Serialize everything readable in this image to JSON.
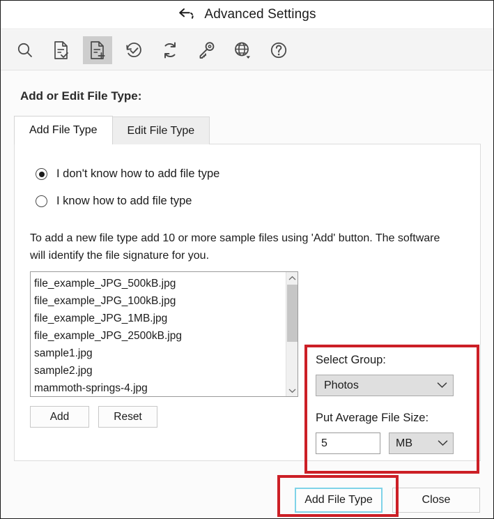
{
  "window": {
    "title": "Advanced Settings",
    "back_icon": "back-arrow-icon"
  },
  "toolbar": {
    "items": [
      {
        "icon": "search-icon",
        "name": "search",
        "active": false
      },
      {
        "icon": "document-check-icon",
        "name": "verify-file-type",
        "active": false
      },
      {
        "icon": "document-plus-icon",
        "name": "add-file-type",
        "active": true
      },
      {
        "icon": "clock-check-icon",
        "name": "recovery-history",
        "active": false
      },
      {
        "icon": "refresh-icon",
        "name": "refresh",
        "active": false
      },
      {
        "icon": "key-icon",
        "name": "license-key",
        "active": false
      },
      {
        "icon": "globe-dropdown-icon",
        "name": "language",
        "active": false
      },
      {
        "icon": "help-question-icon",
        "name": "help",
        "active": false
      }
    ]
  },
  "main": {
    "section_title": "Add or Edit File Type:",
    "tabs": [
      {
        "label": "Add File Type",
        "active": true
      },
      {
        "label": "Edit File Type",
        "active": false
      }
    ],
    "radios": [
      {
        "label": "I don't know how to add file type",
        "checked": true
      },
      {
        "label": "I know how to add file type",
        "checked": false
      }
    ],
    "hint": "To add a new file type add 10 or more sample files using 'Add' button. The software will identify the file signature for you.",
    "file_list": [
      "file_example_JPG_500kB.jpg",
      "file_example_JPG_100kB.jpg",
      "file_example_JPG_1MB.jpg",
      "file_example_JPG_2500kB.jpg",
      "sample1.jpg",
      "sample2.jpg",
      "mammoth-springs-4.jpg"
    ],
    "list_buttons": {
      "add": "Add",
      "reset": "Reset"
    },
    "group_panel": {
      "select_group_label": "Select Group:",
      "select_group_value": "Photos",
      "average_size_label": "Put  Average File Size:",
      "average_size_value": "5",
      "average_size_unit": "MB"
    }
  },
  "footer": {
    "primary_button": "Add File Type",
    "secondary_button": "Close"
  },
  "annotations": {
    "highlight_color": "#cc1f26",
    "focus_color": "#7fd3e8"
  }
}
